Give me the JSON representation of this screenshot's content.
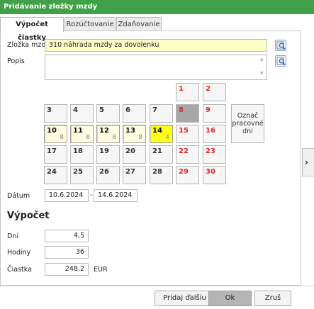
{
  "window": {
    "title": "Pridávanie zložky mzdy"
  },
  "tabs": [
    {
      "label": "Výpočet čiastky"
    },
    {
      "label": "Rozúčtovanie"
    },
    {
      "label": "Zdaňovanie"
    }
  ],
  "form": {
    "component_label": "Zložka mzdy",
    "component_value": "310  náhrada mzdy za dovolenku",
    "description_label": "Popis",
    "description_value": "",
    "date_label": "Dátum",
    "date_from": "10.6.2024",
    "date_separator": "-",
    "date_to": "14.6.2024"
  },
  "calendar": {
    "mark_workdays_label": "Označ pracovné dni",
    "rows": [
      [
        null,
        null,
        null,
        null,
        null,
        {
          "day": "1",
          "type": "weekend"
        },
        {
          "day": "2",
          "type": "weekend"
        }
      ],
      [
        {
          "day": "3",
          "type": "normal"
        },
        {
          "day": "4",
          "type": "normal"
        },
        {
          "day": "5",
          "type": "normal"
        },
        {
          "day": "6",
          "type": "normal"
        },
        {
          "day": "7",
          "type": "normal"
        },
        {
          "day": "8",
          "type": "holiday"
        },
        {
          "day": "9",
          "type": "weekend"
        }
      ],
      [
        {
          "day": "10",
          "type": "work",
          "hours": "8"
        },
        {
          "day": "11",
          "type": "work",
          "hours": "8"
        },
        {
          "day": "12",
          "type": "work",
          "hours": "8"
        },
        {
          "day": "13",
          "type": "work",
          "hours": "8"
        },
        {
          "day": "14",
          "type": "today",
          "hours": "4"
        },
        {
          "day": "15",
          "type": "weekend"
        },
        {
          "day": "16",
          "type": "weekend"
        }
      ],
      [
        {
          "day": "17",
          "type": "normal"
        },
        {
          "day": "18",
          "type": "normal"
        },
        {
          "day": "19",
          "type": "normal"
        },
        {
          "day": "20",
          "type": "normal"
        },
        {
          "day": "21",
          "type": "normal"
        },
        {
          "day": "22",
          "type": "weekend"
        },
        {
          "day": "23",
          "type": "weekend"
        }
      ],
      [
        {
          "day": "24",
          "type": "normal"
        },
        {
          "day": "25",
          "type": "normal"
        },
        {
          "day": "26",
          "type": "normal"
        },
        {
          "day": "27",
          "type": "normal"
        },
        {
          "day": "28",
          "type": "normal"
        },
        {
          "day": "29",
          "type": "weekend"
        },
        {
          "day": "30",
          "type": "weekend"
        }
      ]
    ]
  },
  "calc": {
    "title": "Výpočet",
    "days_label": "Dni",
    "days_value": "4,5",
    "hours_label": "Hodiny",
    "hours_value": "36",
    "amount_label": "Čiastka",
    "amount_value": "248,2",
    "currency": "EUR"
  },
  "buttons": {
    "add_next": "Pridaj ďalšiu",
    "ok": "Ok",
    "cancel": "Zruš"
  },
  "icons": {
    "lookup": "magnifier-icon",
    "side_expand": "chevron-right-icon"
  },
  "colors": {
    "titlebar": "#41a148",
    "weekend_text": "#e02828",
    "workday_bg": "#fffbe0",
    "today_bg": "#ffff1a",
    "holiday_bg": "#a7a7a7"
  }
}
